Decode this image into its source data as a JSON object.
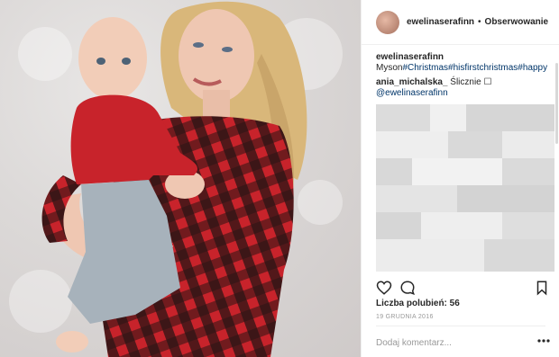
{
  "post": {
    "username": "ewelinaserafinn",
    "separator": "•",
    "follow_label": "Obserwowanie",
    "caption_user": "ewelinaserafinn",
    "caption_text": "Myson",
    "caption_tags": [
      "#Christmas",
      "#hisfirstchristmas",
      "#happy"
    ],
    "comment_user": "ania_michalska_",
    "comment_text": "Ślicznie ☐",
    "comment_mention": "@ewelinaserafinn",
    "likes_text": "Liczba polubień: 56",
    "date_text": "19 GRUDNIA 2016",
    "add_comment_placeholder": "Dodaj komentarz..."
  },
  "icons": {
    "like": "heart-icon",
    "comment": "comment-icon",
    "save": "bookmark-icon",
    "more": "more-options-icon"
  },
  "colors": {
    "text": "#262626",
    "hashtag": "#003569",
    "muted": "#999999",
    "divider": "#efefef",
    "shirt_red": "#c8232b"
  }
}
